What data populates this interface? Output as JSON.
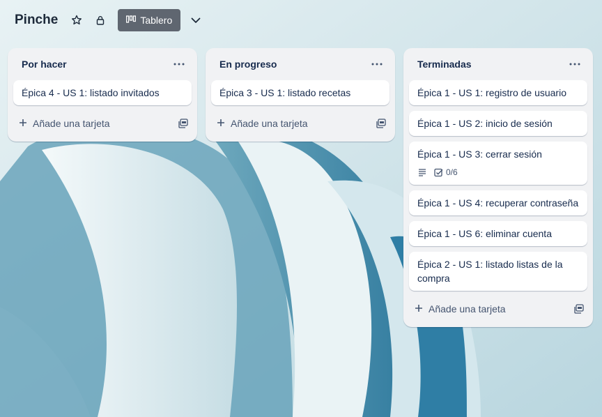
{
  "board": {
    "title": "Pinche",
    "view_label": "Tablero",
    "star_icon": "star-icon",
    "lock_icon": "lock-icon"
  },
  "lists": [
    {
      "title": "Por hacer",
      "cards": [
        "Épica 4 - US 1: listado invitados"
      ],
      "add_label": "Añade una tarjeta"
    },
    {
      "title": "En progreso",
      "cards": [
        "Épica 3 - US 1: listado recetas"
      ],
      "add_label": "Añade una tarjeta"
    },
    {
      "title": "Terminadas",
      "cards": [
        "Épica 1 - US 1: registro de usuario",
        "Épica 1 - US 2: inicio de sesión",
        "Épica 1 - US 3: cerrar sesión",
        "Épica 1 - US 4: recuperar contraseña",
        "Épica 1 - US 6: eliminar cuenta",
        "Épica 2 - US 1: listado listas de la compra"
      ],
      "checklist": "0/6",
      "add_label": "Añade una tarjeta"
    }
  ],
  "colors": {
    "list_bg": "#f1f2f4",
    "view_button_bg": "#5f6670",
    "title_text": "#172b4d"
  }
}
